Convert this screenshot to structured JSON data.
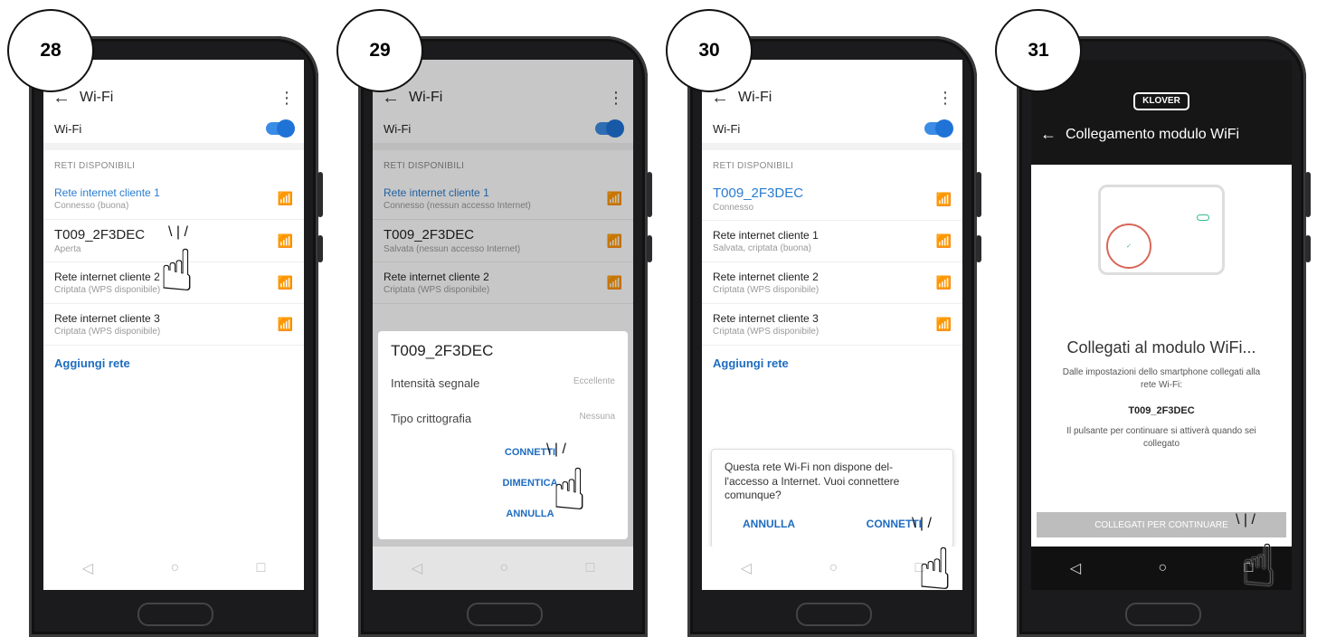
{
  "steps": [
    {
      "number": "28",
      "screen": {
        "title": "Wi-Fi",
        "wifi_label": "Wi-Fi",
        "section": "RETI DISPONIBILI",
        "networks": [
          {
            "name": "Rete internet cliente 1",
            "sub": "Connesso (buona)"
          },
          {
            "name": "T009_2F3DEC",
            "sub": "Aperta"
          },
          {
            "name": "Rete internet cliente 2",
            "sub": "Criptata (WPS disponibile)"
          },
          {
            "name": "Rete internet cliente 3",
            "sub": "Criptata (WPS disponibile)"
          }
        ],
        "add_network": "Aggiungi rete"
      }
    },
    {
      "number": "29",
      "screen": {
        "title": "Wi-Fi",
        "wifi_label": "Wi-Fi",
        "section": "RETI DISPONIBILI",
        "networks": [
          {
            "name": "Rete internet cliente 1",
            "sub": "Connesso (nessun accesso Internet)"
          },
          {
            "name": "T009_2F3DEC",
            "sub": "Salvata (nessun accesso Internet)"
          },
          {
            "name": "Rete internet cliente 2",
            "sub": "Criptata (WPS disponibile)"
          }
        ],
        "sheet": {
          "title": "T009_2F3DEC",
          "signal_label": "Intensità segnale",
          "signal_value": "Eccellente",
          "crypto_label": "Tipo crittografia",
          "crypto_value": "Nessuna",
          "connect": "CONNETTI",
          "forget": "DIMENTICA",
          "cancel": "ANNULLA"
        }
      }
    },
    {
      "number": "30",
      "screen": {
        "title": "Wi-Fi",
        "wifi_label": "Wi-Fi",
        "section": "RETI DISPONIBILI",
        "networks": [
          {
            "name": "T009_2F3DEC",
            "sub": "Connesso"
          },
          {
            "name": "Rete internet cliente 1",
            "sub": "Salvata, criptata (buona)"
          },
          {
            "name": "Rete internet cliente 2",
            "sub": "Criptata (WPS disponibile)"
          },
          {
            "name": "Rete internet cliente 3",
            "sub": "Criptata (WPS disponibile)"
          }
        ],
        "add_network": "Aggiungi rete",
        "dialog": {
          "message": "Questa rete Wi-Fi non dispone del- l'accesso a Internet. Vuoi connettere comunque?",
          "cancel": "ANNULLA",
          "connect": "CONNETTI"
        }
      }
    },
    {
      "number": "31",
      "screen": {
        "logo": "KLOVER",
        "title": "Collegamento modulo WiFi",
        "heading": "Collegati al modulo WiFi...",
        "instruction": "Dalle impostazioni dello smartphone collegati alla rete Wi-Fi:",
        "ssid": "T009_2F3DEC",
        "note": "Il pulsante per continuare si attiverà quando sei collegato",
        "button": "COLLEGATI PER CONTINUARE"
      }
    }
  ]
}
